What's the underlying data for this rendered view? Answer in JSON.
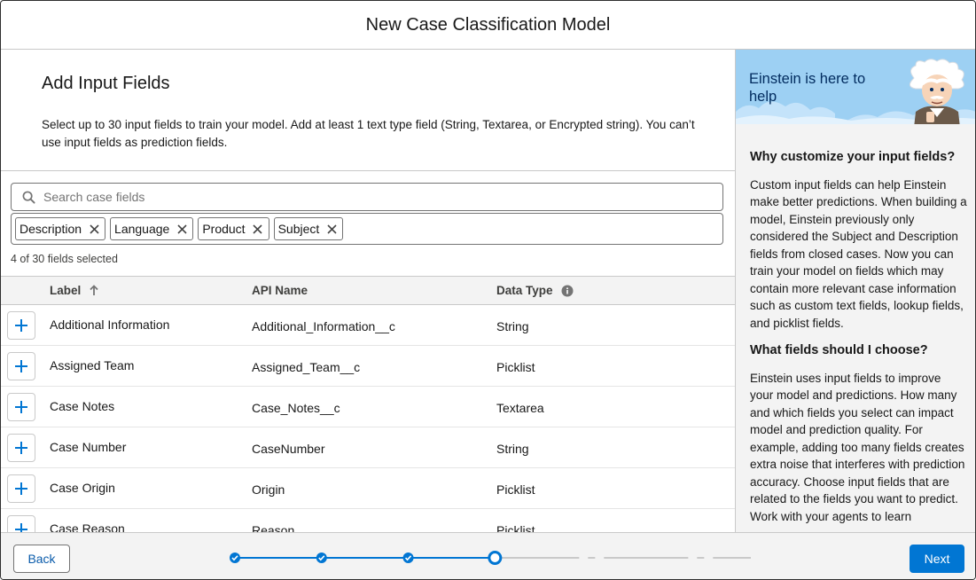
{
  "modal": {
    "title": "New Case Classification Model"
  },
  "intro": {
    "heading": "Add Input Fields",
    "description": "Select up to 30 input fields to train your model. Add at least 1 text type field (String, Textarea, or Encrypted string). You can’t use input fields as prediction fields."
  },
  "search": {
    "placeholder": "Search case fields",
    "value": "",
    "icon": "search-icon"
  },
  "selected_fields": [
    "Description",
    "Language",
    "Product",
    "Subject"
  ],
  "selection_count": "4 of 30 fields selected",
  "table": {
    "columns": {
      "label": "Label",
      "api_name": "API Name",
      "data_type": "Data Type"
    },
    "sort": {
      "column": "label",
      "direction": "ascending",
      "icon": "arrow-up-icon"
    },
    "rows": [
      {
        "label": "Additional Information",
        "api_name": "Additional_Information__c",
        "data_type": "String"
      },
      {
        "label": "Assigned Team",
        "api_name": "Assigned_Team__c",
        "data_type": "Picklist"
      },
      {
        "label": "Case Notes",
        "api_name": "Case_Notes__c",
        "data_type": "Textarea"
      },
      {
        "label": "Case Number",
        "api_name": "CaseNumber",
        "data_type": "String"
      },
      {
        "label": "Case Origin",
        "api_name": "Origin",
        "data_type": "Picklist"
      },
      {
        "label": "Case Reason",
        "api_name": "Reason",
        "data_type": "Picklist"
      }
    ]
  },
  "sidebar": {
    "banner_text": "Einstein is here to help",
    "sections": [
      {
        "heading": "Why customize your input fields?",
        "body": "Custom input fields can help Einstein make better predictions. When building a model, Einstein previously only considered the Subject and Description fields from closed cases. Now you can train your model on fields which may contain more relevant case information such as custom text fields, lookup fields, and picklist fields."
      },
      {
        "heading": "What fields should I choose?",
        "body": "Einstein uses input fields to improve your model and predictions. How many and which fields you select can impact model and prediction quality. For example, adding too many fields creates extra noise that interferes with prediction accuracy. Choose input fields that are related to the fields you want to predict. Work with your agents to learn"
      }
    ]
  },
  "footer": {
    "back_label": "Back",
    "next_label": "Next",
    "progress": {
      "current_step": 4,
      "completed_steps": 3
    }
  },
  "colors": {
    "brand": "#0176d3",
    "link": "#0b5cab",
    "banner": "#9dd0f3",
    "border": "#c9c9c9"
  }
}
